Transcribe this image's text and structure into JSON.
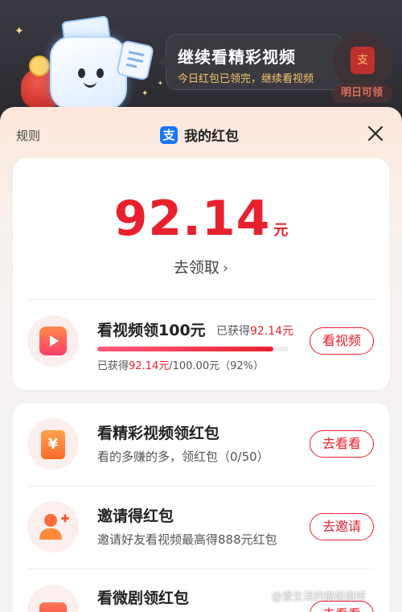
{
  "banner": {
    "title": "继续看精彩视频",
    "subtitle": "今日红包已领完，继续看视频",
    "side_label": "明日可领",
    "side_bag_char": "支"
  },
  "sheet": {
    "rules_label": "规则",
    "title": "我的红包",
    "app_icon_char": "支"
  },
  "balance": {
    "amount": "92.14",
    "unit": "元",
    "claim_label": "去领取"
  },
  "watch_task": {
    "title": "看视频领100元",
    "earned_prefix": "已获得",
    "earned_value": "92.14元",
    "progress_prefix": "已获得",
    "progress_value": "92.14元",
    "progress_suffix": "/100.00元（92%）",
    "progress": 0.9214,
    "button": "看视频"
  },
  "tasks": [
    {
      "title": "看精彩视频领红包",
      "subtitle": "看的多赚的多，领红包（0/50）",
      "button": "去看看",
      "icon": "yen-icon",
      "icon_char": "¥"
    },
    {
      "title": "邀请得红包",
      "subtitle": "邀请好友看视频最高得888元红包",
      "button": "去邀请",
      "icon": "person-add-icon"
    },
    {
      "title": "看微剧领红包",
      "subtitle": "",
      "button": "去看看",
      "icon": "drama-icon"
    }
  ],
  "watermark": "@爱生活的猫姐姐呀",
  "colors": {
    "accent": "#e8202e",
    "alipay_blue": "#1677ff"
  }
}
